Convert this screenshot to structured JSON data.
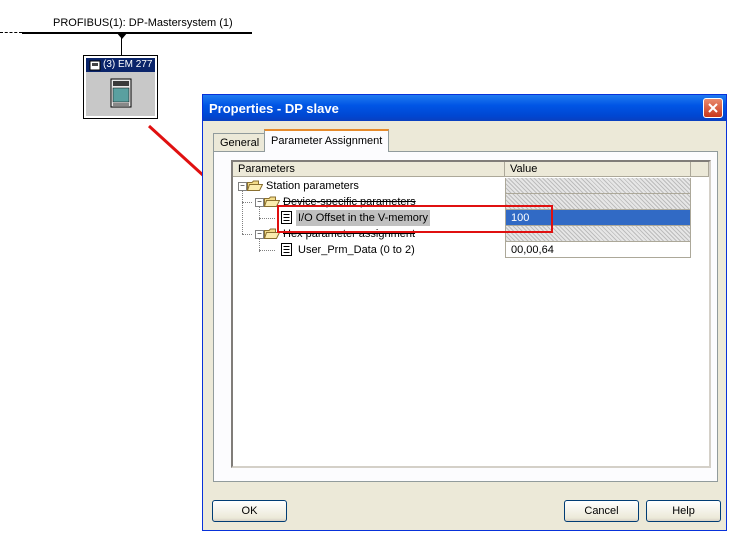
{
  "network": {
    "bus_label": "PROFIBUS(1): DP-Mastersystem (1)",
    "station_label": "(3) EM 277"
  },
  "dialog": {
    "title": "Properties - DP slave",
    "tabs": [
      {
        "label": "General",
        "active": false
      },
      {
        "label": "Parameter Assignment",
        "active": true
      }
    ],
    "grid": {
      "columns": [
        "Parameters",
        "Value"
      ],
      "rows": [
        {
          "label": "Station parameters",
          "value": "",
          "level": 0,
          "type": "folder",
          "expander": "−"
        },
        {
          "label": "Device-specific parameters",
          "value": "",
          "level": 1,
          "type": "folder",
          "expander": "−"
        },
        {
          "label": "I/O Offset in the V-memory",
          "value": "100",
          "level": 2,
          "type": "param",
          "selected": true
        },
        {
          "label": "Hex parameter assignment",
          "value": "",
          "level": 1,
          "type": "folder",
          "expander": "−"
        },
        {
          "label": "User_Prm_Data (0 to 2)",
          "value": "00,00,64",
          "level": 2,
          "type": "param"
        }
      ]
    },
    "buttons": {
      "ok": "OK",
      "cancel": "Cancel",
      "help": "Help"
    }
  },
  "colors": {
    "titlebar": "#0055e5",
    "selection": "#316ac5",
    "annotation": "#e01010",
    "active_tab_accent": "#e68b2c"
  }
}
